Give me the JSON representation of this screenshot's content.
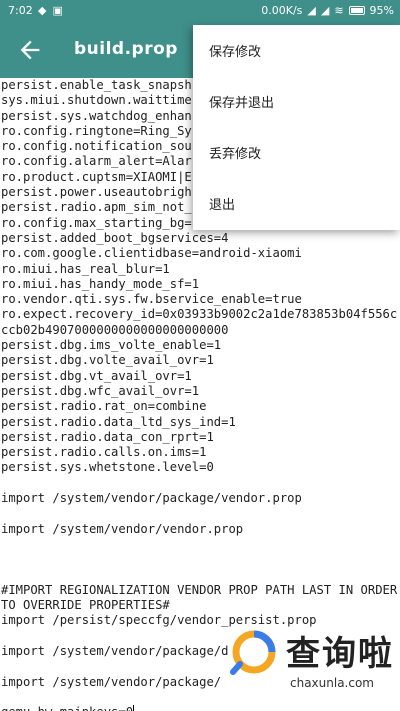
{
  "status_bar": {
    "time": "7:02",
    "speed": "0.00K/s",
    "battery": "95%"
  },
  "app_bar": {
    "title": "build.prop"
  },
  "menu": {
    "items": [
      "保存修改",
      "保存并退出",
      "丢弃修改",
      "退出"
    ]
  },
  "editor": {
    "lines": [
      "persist.enable_task_snapsh",
      "sys.miui.shutdown.waittime",
      "persist.sys.watchdog_enhan",
      "ro.config.ringtone=Ring_Sy",
      "ro.config.notification_sou",
      "ro.config.alarm_alert=Alar",
      "ro.product.cuptsm=XIAOMI|E",
      "persist.power.useautobrigh",
      "persist.radio.apm_sim_not_",
      "ro.config.max_starting_bg=",
      "persist.added_boot_bgservices=4",
      "ro.com.google.clientidbase=android-xiaomi",
      "ro.miui.has_real_blur=1",
      "ro.miui.has_handy_mode_sf=1",
      "ro.vendor.qti.sys.fw.bservice_enable=true",
      "ro.expect.recovery_id=0x03933b9002c2a1de783853b04f556c",
      "ccb02b4907000000000000000000000",
      "persist.dbg.ims_volte_enable=1",
      "persist.dbg.volte_avail_ovr=1",
      "persist.dbg.vt_avail_ovr=1",
      "persist.dbg.wfc_avail_ovr=1",
      "persist.radio.rat_on=combine",
      "persist.radio.data_ltd_sys_ind=1",
      "persist.radio.data_con_rprt=1",
      "persist.radio.calls.on.ims=1",
      "persist.sys.whetstone.level=0",
      "",
      "import /system/vendor/package/vendor.prop",
      "",
      "import /system/vendor/vendor.prop",
      "",
      "",
      "",
      "#IMPORT REGIONALIZATION VENDOR PROP PATH LAST IN ORDER",
      "TO OVERRIDE PROPERTIES#",
      "import /persist/speccfg/vendor_persist.prop",
      "",
      "import /system/vendor/package/d",
      "",
      "import /system/vendor/package/",
      "",
      "qemu.hw.mainkeys=0"
    ]
  },
  "watermark": {
    "text": "查询啦",
    "domain": "chaxunla.com"
  },
  "colors": {
    "primary": "#3f8f8a",
    "menu_bg": "#ffffff",
    "text": "#222222"
  }
}
